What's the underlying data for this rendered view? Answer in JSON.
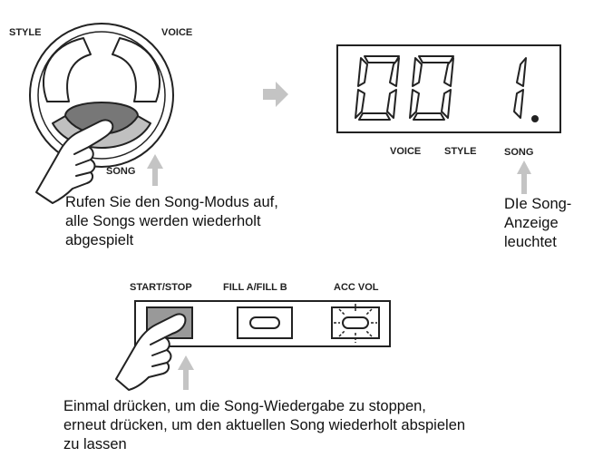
{
  "mode_dial": {
    "label_style": "STYLE",
    "label_voice": "VOICE",
    "label_song": "SONG"
  },
  "display": {
    "digits": "001.",
    "label_voice": "VOICE",
    "label_style": "STYLE",
    "label_song": "SONG"
  },
  "caption_mode": {
    "line1": "Rufen Sie den Song-Modus auf,",
    "line2": "alle Songs werden wiederholt",
    "line3": "abgespielt"
  },
  "caption_indicator": {
    "line1": "DIe Song-",
    "line2": "Anzeige",
    "line3": "leuchtet"
  },
  "panel": {
    "start_stop_label": "START/STOP",
    "fill_label": "FILL A/FILL B",
    "acc_vol_label": "ACC VOL"
  },
  "caption_start_stop": {
    "line1": "Einmal drücken, um die Song-Wiedergabe zu stoppen,",
    "line2": "erneut drücken, um den aktuellen Song wiederholt abspielen",
    "line3": "zu lassen"
  },
  "colors": {
    "song_button": "#777777",
    "start_stop_button": "#999999",
    "song_ring": "#c0c0c0",
    "arrow": "#c4c4c4",
    "ink": "#222222"
  }
}
